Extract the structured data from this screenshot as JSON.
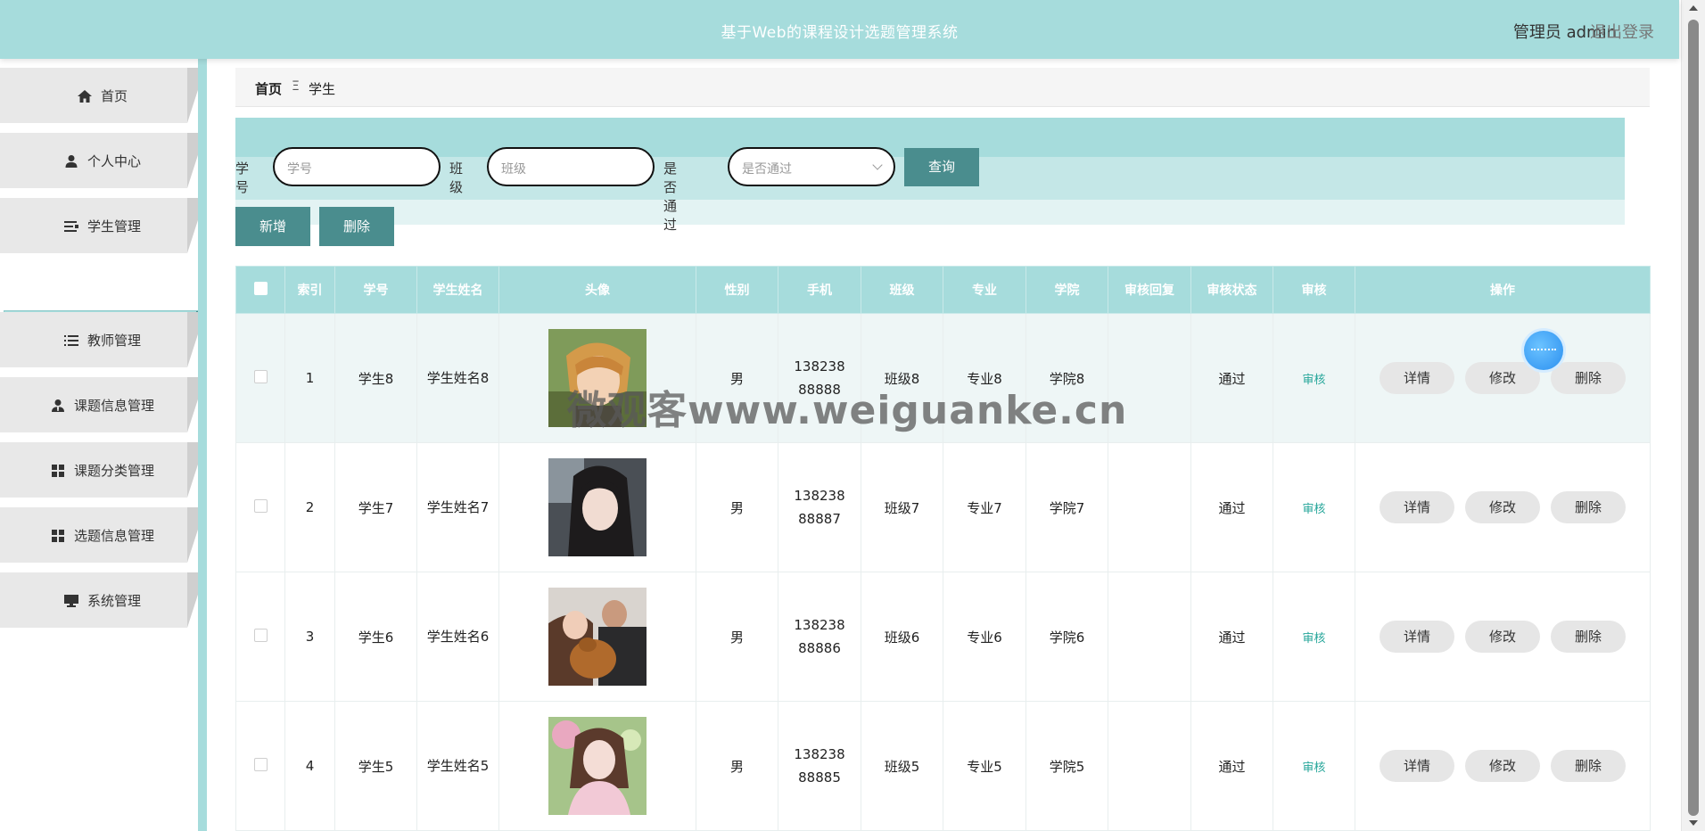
{
  "header": {
    "title": "基于Web的课程设计选题管理系统",
    "user_label": "管理员 admin",
    "logout_label": "退出登录"
  },
  "sidebar": {
    "items": [
      {
        "label": "首页",
        "icon": "home-icon"
      },
      {
        "label": "个人中心",
        "icon": "user-icon"
      },
      {
        "label": "学生管理",
        "icon": "list-icon"
      },
      {
        "label": "教师管理",
        "icon": "list-icon"
      },
      {
        "label": "课题信息管理",
        "icon": "user-tie-icon"
      },
      {
        "label": "课题分类管理",
        "icon": "grid-icon"
      },
      {
        "label": "选题信息管理",
        "icon": "grid-icon"
      },
      {
        "label": "系统管理",
        "icon": "monitor-icon"
      }
    ],
    "active_sub": "学生"
  },
  "breadcrumb": {
    "home": "首页",
    "separator": "Ξ",
    "current": "学生"
  },
  "search": {
    "student_id_label": "学号",
    "student_id_placeholder": "学号",
    "class_label": "班级",
    "class_placeholder": "班级",
    "passed_label": "是否通过",
    "passed_placeholder": "是否通过",
    "query_button": "查询"
  },
  "actions": {
    "add_button": "新增",
    "delete_button": "删除"
  },
  "table": {
    "headers": [
      "",
      "索引",
      "学号",
      "学生姓名",
      "头像",
      "性别",
      "手机",
      "班级",
      "专业",
      "学院",
      "审核回复",
      "审核状态",
      "审核",
      "操作"
    ],
    "rows": [
      {
        "index": "1",
        "student_id": "学生8",
        "name": "学生姓名8",
        "gender": "男",
        "phone": "13823888888",
        "class": "班级8",
        "major": "专业8",
        "college": "学院8",
        "reply": "",
        "status": "通过",
        "audit": "审核"
      },
      {
        "index": "2",
        "student_id": "学生7",
        "name": "学生姓名7",
        "gender": "男",
        "phone": "13823888887",
        "class": "班级7",
        "major": "专业7",
        "college": "学院7",
        "reply": "",
        "status": "通过",
        "audit": "审核"
      },
      {
        "index": "3",
        "student_id": "学生6",
        "name": "学生姓名6",
        "gender": "男",
        "phone": "13823888886",
        "class": "班级6",
        "major": "专业6",
        "college": "学院6",
        "reply": "",
        "status": "通过",
        "audit": "审核"
      },
      {
        "index": "4",
        "student_id": "学生5",
        "name": "学生姓名5",
        "gender": "男",
        "phone": "13823888885",
        "class": "班级5",
        "major": "专业5",
        "college": "学院5",
        "reply": "",
        "status": "通过",
        "audit": "审核"
      }
    ],
    "row_buttons": {
      "detail": "详情",
      "edit": "修改",
      "delete": "删除"
    }
  },
  "watermark": "微观客www.weiguanke.cn",
  "colors": {
    "accent": "#a6dcdc",
    "button": "#4a8d8e",
    "audit_link": "#26a69a"
  }
}
